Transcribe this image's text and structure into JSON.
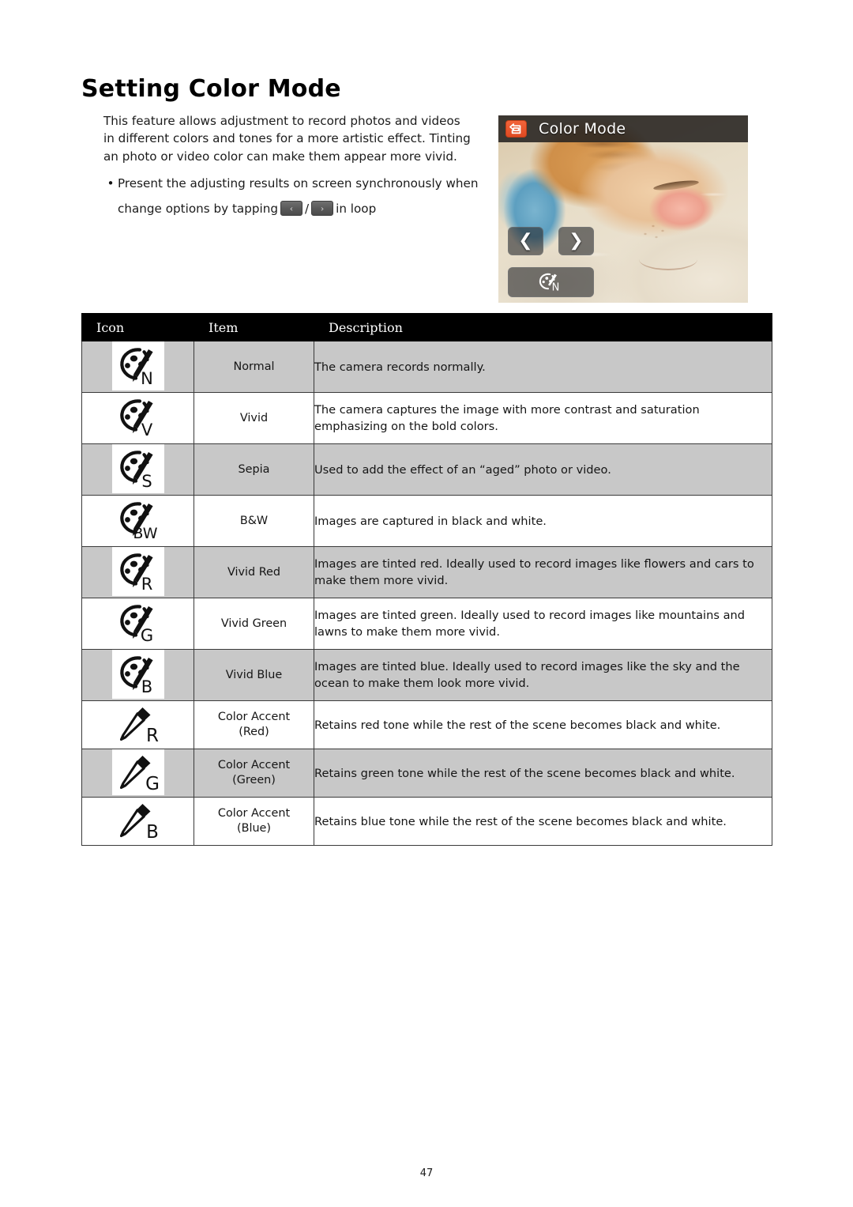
{
  "page": {
    "title": "Setting Color Mode",
    "number": "47"
  },
  "intro": {
    "paragraph": "This feature allows adjustment to record photos and videos in different colors and tones for a more artistic effect.  Tinting an photo or video color can make them appear more vivid.",
    "bullet": {
      "marker": "•",
      "line1": "Present the adjusting results on screen synchronously when",
      "line2_before": "change options by tapping",
      "separator": "/",
      "line2_after": "in loop",
      "prev_icon": "chevron-left-icon",
      "next_icon": "chevron-right-icon",
      "prev_glyph": "‹",
      "next_glyph": "›"
    }
  },
  "camera_preview": {
    "header_title": "Color Mode",
    "back_icon": "return-arrow-icon",
    "prev_button": {
      "icon": "chevron-left-icon",
      "glyph": "❮"
    },
    "next_button": {
      "icon": "chevron-right-icon",
      "glyph": "❯"
    },
    "mode_button": {
      "icon": "palette-normal-icon",
      "letter": "N"
    },
    "scene_description": "sleeping orange tabby cat",
    "header_bg": "#262220",
    "back_icon_color": "#e04a22"
  },
  "table": {
    "headers": [
      "Icon",
      "Item",
      "Description"
    ],
    "rows": [
      {
        "icon_type": "palette",
        "icon_letter": "N",
        "icon_name": "palette-normal-icon",
        "item": "Normal",
        "description": "The camera records normally.",
        "shaded": true,
        "plate": true
      },
      {
        "icon_type": "palette",
        "icon_letter": "V",
        "icon_name": "palette-vivid-icon",
        "item": "Vivid",
        "description": "The camera captures the image with more contrast and saturation emphasizing on the bold colors.",
        "shaded": false,
        "plate": false
      },
      {
        "icon_type": "palette",
        "icon_letter": "S",
        "icon_name": "palette-sepia-icon",
        "item": "Sepia",
        "description": "Used to add the effect of an “aged” photo or video.",
        "shaded": true,
        "plate": true
      },
      {
        "icon_type": "palette",
        "icon_letter": "BW",
        "icon_name": "palette-bw-icon",
        "item": "B&W",
        "description": "Images are captured in black and white.",
        "shaded": false,
        "plate": false
      },
      {
        "icon_type": "palette",
        "icon_letter": "R",
        "icon_name": "palette-vivid-red-icon",
        "item": "Vivid Red",
        "description": "Images are tinted red.  Ideally used to record images like flowers and cars to make them more vivid.",
        "shaded": true,
        "plate": true
      },
      {
        "icon_type": "palette",
        "icon_letter": "G",
        "icon_name": "palette-vivid-green-icon",
        "item": "Vivid Green",
        "description": "Images are tinted green.  Ideally used to record images like mountains and lawns to make them more vivid.",
        "shaded": false,
        "plate": false
      },
      {
        "icon_type": "palette",
        "icon_letter": "B",
        "icon_name": "palette-vivid-blue-icon",
        "item": "Vivid Blue",
        "description": "Images are tinted blue.  Ideally used to record images like the sky and the ocean to make them look more vivid.",
        "shaded": true,
        "plate": true
      },
      {
        "icon_type": "eyedropper",
        "icon_letter": "R",
        "icon_name": "eyedropper-red-icon",
        "item": "Color Accent\n(Red)",
        "description": "Retains red tone while the rest of the scene becomes black and white.",
        "shaded": false,
        "plate": false
      },
      {
        "icon_type": "eyedropper",
        "icon_letter": "G",
        "icon_name": "eyedropper-green-icon",
        "item": "Color Accent\n(Green)",
        "description": "Retains green tone while the rest of the scene becomes black and white.",
        "shaded": true,
        "plate": true
      },
      {
        "icon_type": "eyedropper",
        "icon_letter": "B",
        "icon_name": "eyedropper-blue-icon",
        "item": "Color Accent\n(Blue)",
        "description": "Retains blue tone while the rest of the scene becomes black and white.",
        "shaded": false,
        "plate": false
      }
    ]
  }
}
